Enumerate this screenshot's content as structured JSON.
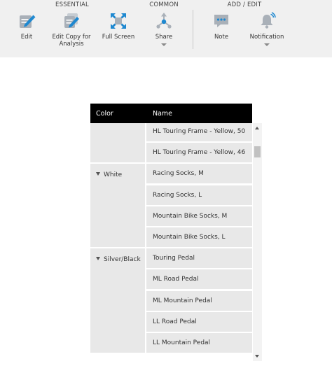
{
  "toolbar": {
    "groups": {
      "essential": "ESSENTIAL",
      "common": "COMMON",
      "add_edit": "ADD / EDIT"
    },
    "buttons": {
      "edit": {
        "label": "Edit",
        "icon": "edit-icon"
      },
      "edit_copy": {
        "label_line1": "Edit Copy for",
        "label_line2": "Analysis",
        "icon": "edit-copy-icon"
      },
      "full_screen": {
        "label": "Full Screen",
        "icon": "full-screen-icon"
      },
      "share": {
        "label": "Share",
        "icon": "share-icon"
      },
      "note": {
        "label": "Note",
        "icon": "note-icon"
      },
      "notification": {
        "label": "Notification",
        "icon": "bell-icon"
      }
    },
    "accent_color": "#1e88d0"
  },
  "table": {
    "headers": {
      "color": "Color",
      "name": "Name"
    },
    "groups": [
      {
        "color": "",
        "names": [
          "HL Touring Frame - Yellow, 50",
          "HL Touring Frame - Yellow, 46"
        ]
      },
      {
        "color": "White",
        "names": [
          "Racing Socks, M",
          "Racing Socks, L",
          "Mountain Bike Socks, M",
          "Mountain Bike Socks, L"
        ]
      },
      {
        "color": "Silver/Black",
        "names": [
          "Touring Pedal",
          "ML Road Pedal",
          "ML Mountain Pedal",
          "LL Road Pedal",
          "LL Mountain Pedal"
        ]
      }
    ]
  }
}
